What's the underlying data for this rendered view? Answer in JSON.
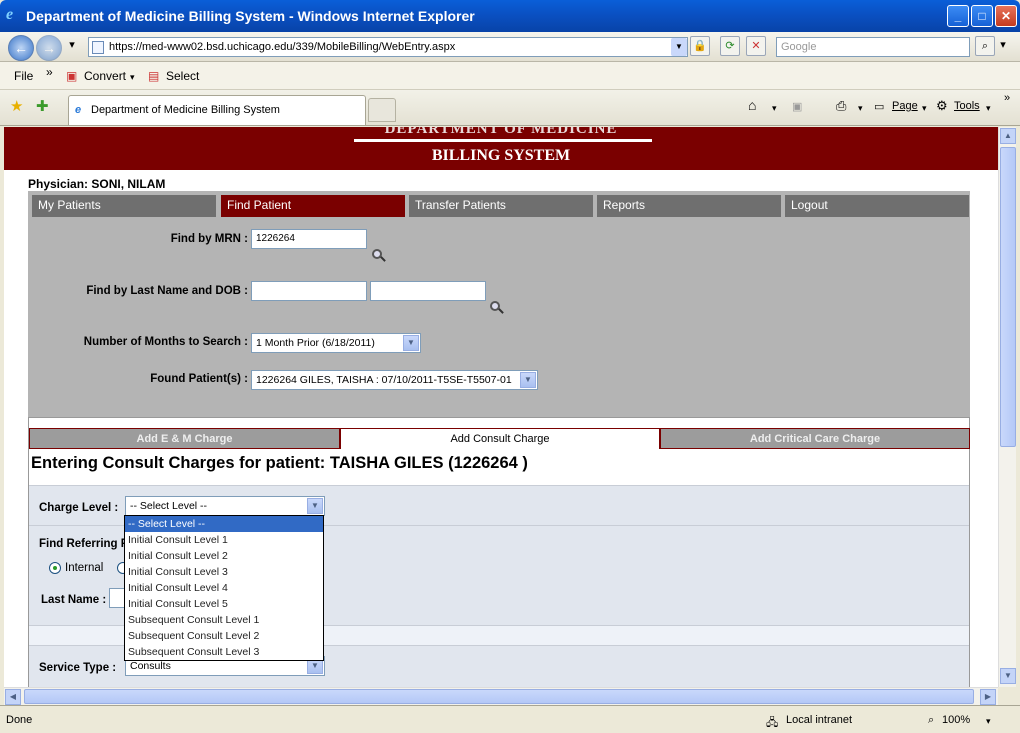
{
  "window": {
    "title": "Department of Medicine Billing System - Windows Internet Explorer",
    "minimize": "_",
    "maximize": "□",
    "close": "✕"
  },
  "address": {
    "url": "https://med-www02.bsd.uchicago.edu/339/MobileBilling/WebEntry.aspx",
    "search_placeholder": "Google"
  },
  "menu": {
    "file": "File",
    "chevron": "»",
    "convert": "Convert",
    "select": "Select"
  },
  "browser_tab": {
    "label": "Department of Medicine Billing System",
    "page": "Page",
    "tools": "Tools"
  },
  "banner": {
    "line1": "DEPARTMENT OF MEDICINE",
    "line2": "BILLING SYSTEM"
  },
  "physician": "Physician: SONI, NILAM",
  "nav": [
    "My Patients",
    "Find Patient",
    "Transfer Patients",
    "Reports",
    "Logout"
  ],
  "find": {
    "mrn_label": "Find by MRN :",
    "mrn_value": "1226264",
    "name_dob_label": "Find by Last Name and DOB :",
    "months_label": "Number of Months to Search :",
    "months_value": "1 Month Prior (6/18/2011)",
    "found_label": "Found Patient(s) :",
    "found_value": "1226264 GILES, TAISHA : 07/10/2011-T5SE-T5507-01"
  },
  "charge_tabs": [
    "Add E & M Charge",
    "Add Consult Charge",
    "Add Critical Care Charge"
  ],
  "heading": "Entering Consult Charges for patient: TAISHA GILES (1226264 )",
  "form": {
    "charge_level_label": "Charge Level :",
    "charge_level_value": "-- Select Level --",
    "referring_label": "Find Referring P",
    "internal_label": "Internal",
    "last_name_label": "Last Name :",
    "service_type_label": "Service Type :",
    "service_type_value": "Consults"
  },
  "dropdown_options": [
    "-- Select Level --",
    "Initial Consult Level 1",
    "Initial Consult Level 2",
    "Initial Consult Level 3",
    "Initial Consult Level 4",
    "Initial Consult Level 5",
    "Subsequent Consult Level 1",
    "Subsequent Consult Level 2",
    "Subsequent Consult Level 3"
  ],
  "status": {
    "left": "Done",
    "zone": "Local intranet",
    "zoom": "100%"
  }
}
